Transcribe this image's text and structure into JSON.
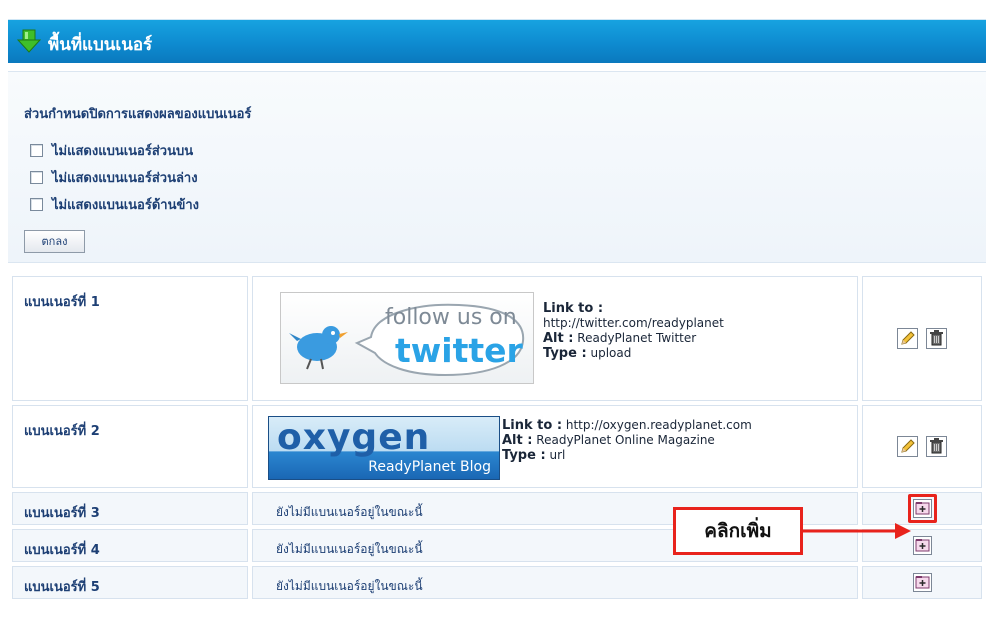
{
  "section": {
    "title": "พื้นที่แบนเนอร์"
  },
  "settings": {
    "heading": "ส่วนกำหนดปิดการแสดงผลของแบนเนอร์",
    "options": [
      {
        "label": "ไม่แสดงแบนเนอร์ส่วนบน",
        "checked": false
      },
      {
        "label": "ไม่แสดงแบนเนอร์ส่วนล่าง",
        "checked": false
      },
      {
        "label": "ไม่แสดงแบนเนอร์ด้านข้าง",
        "checked": false
      }
    ],
    "ok_label": "ตกลง"
  },
  "banners": [
    {
      "name": "แบนเนอร์ที่ 1",
      "image_text_1": "follow us on",
      "image_text_2": "twitter",
      "link_label": "Link to :",
      "link_value": "http://twitter.com/readyplanet",
      "alt_label": "Alt :",
      "alt_value": "ReadyPlanet Twitter",
      "type_label": "Type :",
      "type_value": "upload"
    },
    {
      "name": "แบนเนอร์ที่ 2",
      "image_text_1": "oxygen",
      "image_text_2": "ReadyPlanet Blog",
      "link_label": "Link to :",
      "link_value": "http://oxygen.readyplanet.com",
      "alt_label": "Alt :",
      "alt_value": "ReadyPlanet Online Magazine",
      "type_label": "Type :",
      "type_value": "url"
    },
    {
      "name": "แบนเนอร์ที่ 3",
      "status": "ยังไม่มีแบนเนอร์อยู่ในขณะนี้"
    },
    {
      "name": "แบนเนอร์ที่ 4",
      "status": "ยังไม่มีแบนเนอร์อยู่ในขณะนี้"
    },
    {
      "name": "แบนเนอร์ที่ 5",
      "status": "ยังไม่มีแบนเนอร์อยู่ในขณะนี้"
    }
  ],
  "callout": {
    "text": "คลิกเพิ่ม",
    "color": "#e8231c"
  },
  "icons": {
    "header": "green-down-arrow-icon",
    "edit": "pencil-icon",
    "delete": "trash-icon",
    "add": "add-folder-icon"
  },
  "colors": {
    "header_bg": "#0e8bd0",
    "label_text": "#1d3f74"
  }
}
